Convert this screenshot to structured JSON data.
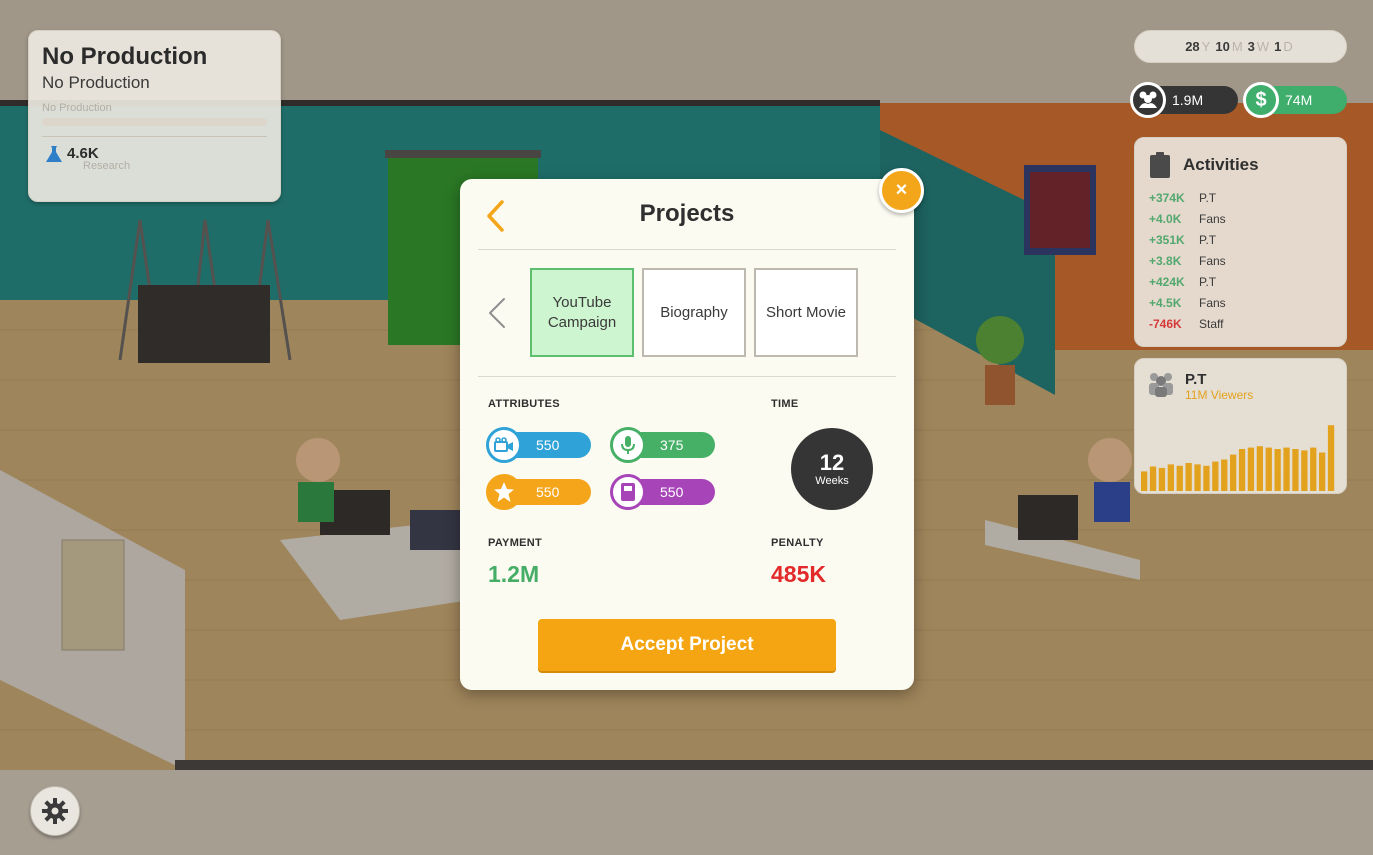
{
  "production": {
    "title": "No Production",
    "subtitle": "No Production",
    "status": "No Production",
    "research_value": "4.6K",
    "research_label": "Research"
  },
  "date": {
    "years": "28",
    "years_unit": "Y",
    "months": "10",
    "months_unit": "M",
    "weeks": "3",
    "weeks_unit": "W",
    "days": "1",
    "days_unit": "D"
  },
  "resources": {
    "fans": "1.9M",
    "money": "74M",
    "money_icon": "$"
  },
  "activities": {
    "title": "Activities",
    "items": [
      {
        "amount": "+374K",
        "label": "P.T",
        "type": "positive"
      },
      {
        "amount": "+4.0K",
        "label": "Fans",
        "type": "positive"
      },
      {
        "amount": "+351K",
        "label": "P.T",
        "type": "positive"
      },
      {
        "amount": "+3.8K",
        "label": "Fans",
        "type": "positive"
      },
      {
        "amount": "+424K",
        "label": "P.T",
        "type": "positive"
      },
      {
        "amount": "+4.5K",
        "label": "Fans",
        "type": "positive"
      },
      {
        "amount": "-746K",
        "label": "Staff",
        "type": "negative"
      }
    ]
  },
  "pt_panel": {
    "title": "P.T",
    "viewers": "11M Viewers",
    "bar_levels": [
      0.28,
      0.35,
      0.33,
      0.38,
      0.36,
      0.4,
      0.38,
      0.36,
      0.42,
      0.45,
      0.52,
      0.6,
      0.62,
      0.64,
      0.62,
      0.6,
      0.62,
      0.6,
      0.58,
      0.62,
      0.55,
      0.94
    ],
    "bar_color": "#e3a21e"
  },
  "modal": {
    "title": "Projects",
    "close_icon": "×",
    "project_types": [
      {
        "label": "YouTube Campaign",
        "line1": "YouTube",
        "line2": "Campaign",
        "selected": true
      },
      {
        "label": "Biography",
        "line1": "Biography",
        "line2": "",
        "selected": false
      },
      {
        "label": "Short Movie",
        "line1": "Short Movie",
        "line2": "",
        "selected": false
      }
    ],
    "attributes_label": "ATTRIBUTES",
    "time_label": "TIME",
    "attributes": {
      "cinematography": "550",
      "audio": "375",
      "star_power": "550",
      "script": "550"
    },
    "time_value": "12",
    "time_unit": "Weeks",
    "payment_label": "PAYMENT",
    "payment_value": "1.2M",
    "penalty_label": "PENALTY",
    "penalty_value": "485K",
    "accept_label": "Accept Project"
  },
  "colors": {
    "accent_orange": "#f5a511",
    "positive_green": "#45ad66",
    "negative_red": "#e22a2a",
    "attr_blue": "#2fa3d7",
    "attr_green": "#46b067",
    "attr_orange": "#f4a519",
    "attr_purple": "#a745b8"
  }
}
